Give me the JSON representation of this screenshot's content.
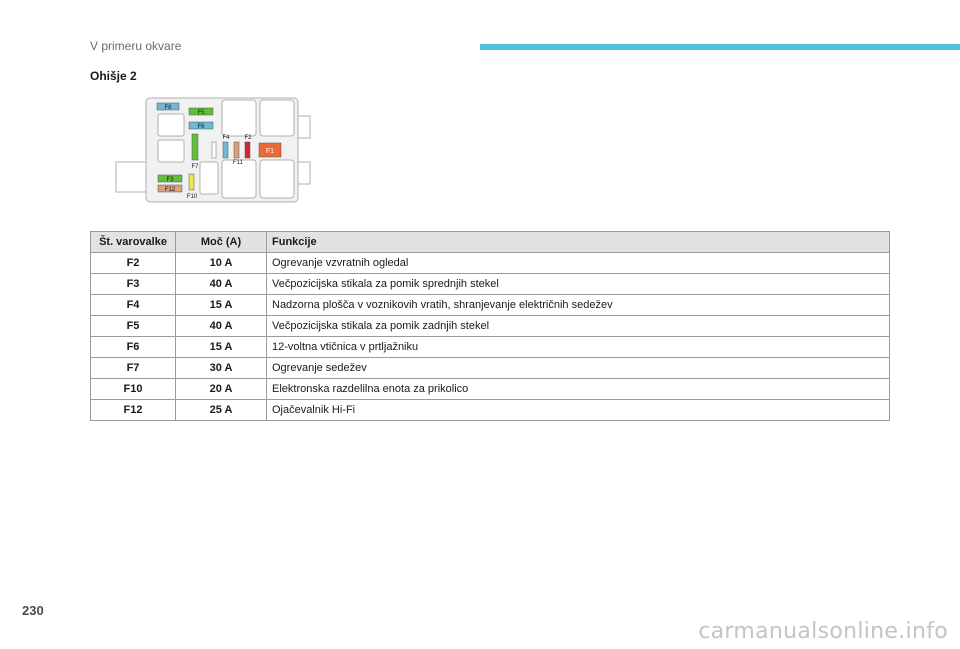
{
  "header": {
    "section_text": "V primeru okvare"
  },
  "section_title": "Ohišje 2",
  "diagram": {
    "labels": {
      "f8": "F8",
      "f5": "F5",
      "f6": "F6",
      "f4": "F4",
      "f2": "F2",
      "f1": "F1",
      "f7": "F7",
      "f11": "F11",
      "f3": "F3",
      "f12": "F12",
      "f10": "F10"
    },
    "colors": {
      "blue": "#6fb8d8",
      "green": "#5fc13a",
      "orange": "#ec6a3a",
      "red": "#d9232a",
      "tan": "#d9a07a",
      "yellow": "#f0e64a"
    }
  },
  "table": {
    "headers": [
      "Št. varovalke",
      "Moč (A)",
      "Funkcije"
    ],
    "rows": [
      {
        "fuse": "F2",
        "amp": "10 A",
        "func": "Ogrevanje vzvratnih ogledal"
      },
      {
        "fuse": "F3",
        "amp": "40 A",
        "func": "Večpozicijska stikala za pomik sprednjih stekel"
      },
      {
        "fuse": "F4",
        "amp": "15 A",
        "func": "Nadzorna plošča v voznikovih vratih, shranjevanje električnih sedežev"
      },
      {
        "fuse": "F5",
        "amp": "40 A",
        "func": "Večpozicijska stikala za pomik zadnjih stekel"
      },
      {
        "fuse": "F6",
        "amp": "15 A",
        "func": "12-voltna vtičnica v prtljažniku"
      },
      {
        "fuse": "F7",
        "amp": "30 A",
        "func": "Ogrevanje sedežev"
      },
      {
        "fuse": "F10",
        "amp": "20 A",
        "func": "Elektronska razdelilna enota za prikolico"
      },
      {
        "fuse": "F12",
        "amp": "25 A",
        "func": "Ojačevalnik Hi-Fi"
      }
    ]
  },
  "page_number": "230",
  "watermark": "carmanualsonline.info"
}
